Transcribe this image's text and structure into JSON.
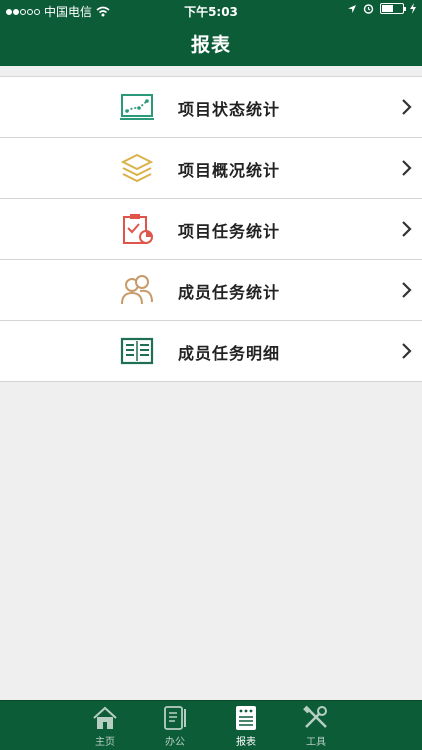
{
  "status_bar": {
    "carrier": "中国电信",
    "time": "下午5:03"
  },
  "header": {
    "title": "报表"
  },
  "menu": [
    {
      "label": "项目状态统计",
      "icon": "line-chart-icon",
      "icon_color": "#2a9a7a"
    },
    {
      "label": "项目概况统计",
      "icon": "layers-icon",
      "icon_color": "#d9b24a"
    },
    {
      "label": "项目任务统计",
      "icon": "clipboard-pie-icon",
      "icon_color": "#e0554a"
    },
    {
      "label": "成员任务统计",
      "icon": "users-icon",
      "icon_color": "#c89a6a"
    },
    {
      "label": "成员任务明细",
      "icon": "detail-list-icon",
      "icon_color": "#1f6f55"
    }
  ],
  "tabbar": [
    {
      "label": "主页",
      "icon": "home-icon",
      "active": false
    },
    {
      "label": "办公",
      "icon": "document-pen-icon",
      "active": false
    },
    {
      "label": "报表",
      "icon": "report-icon",
      "active": true
    },
    {
      "label": "工具",
      "icon": "tools-icon",
      "active": false
    }
  ],
  "colors": {
    "brand": "#0c5c38",
    "background": "#efefef"
  }
}
